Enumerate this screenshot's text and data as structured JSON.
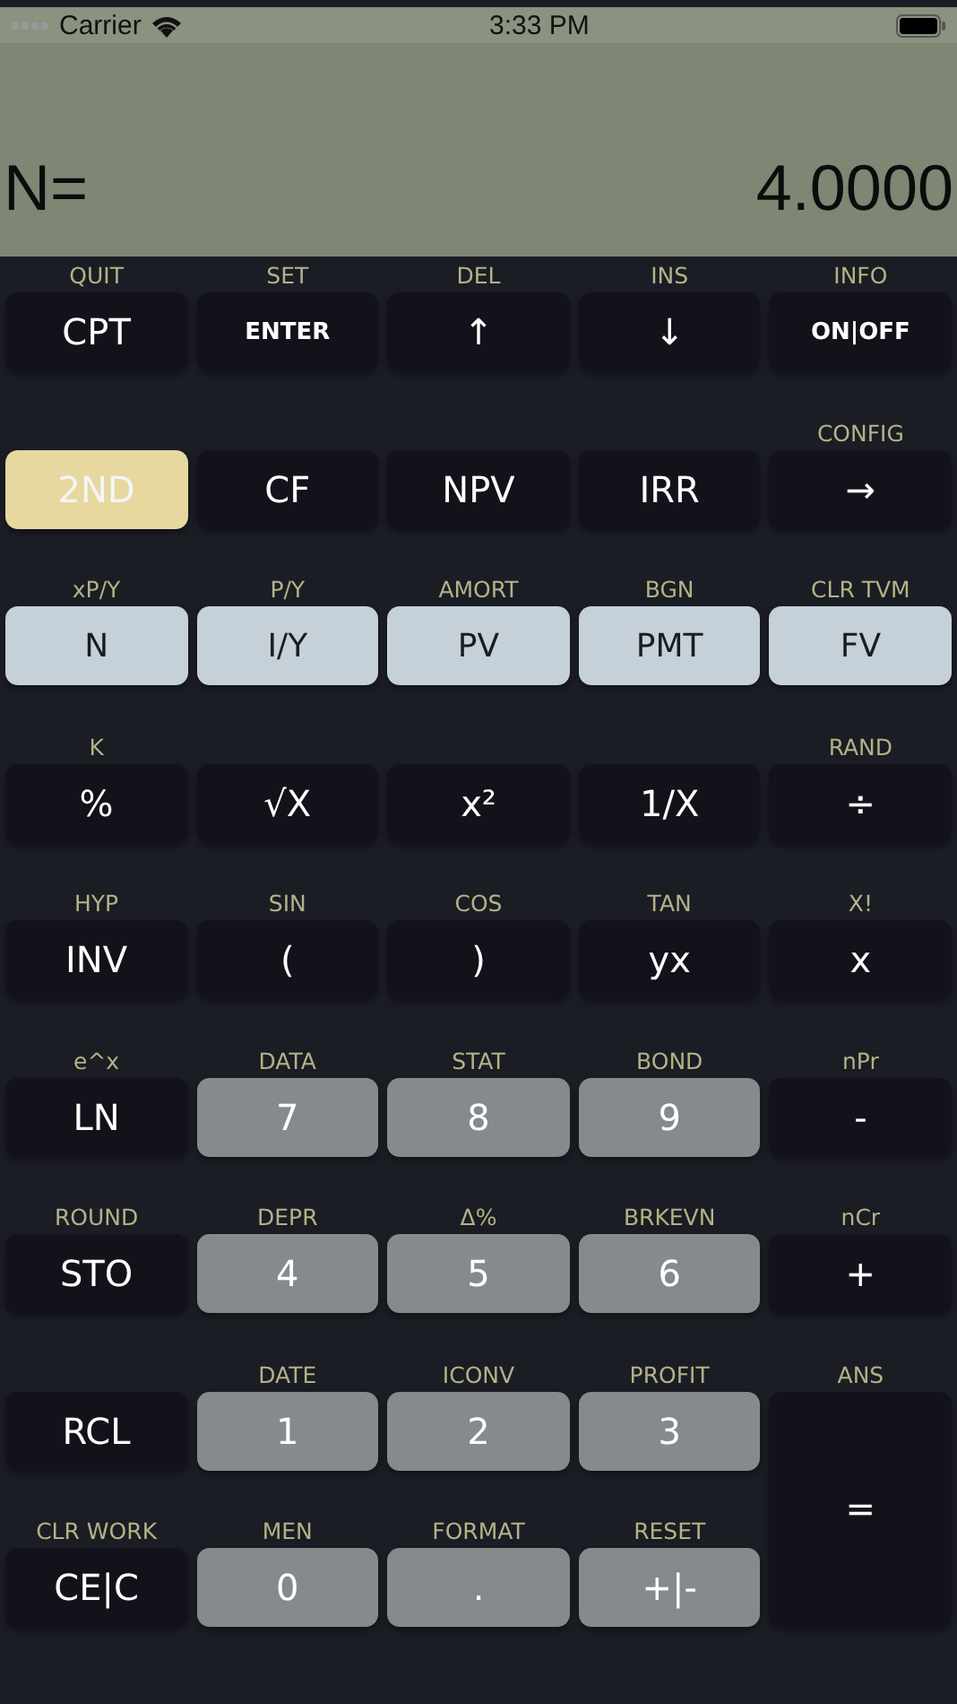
{
  "status_bar": {
    "carrier": "Carrier",
    "time": "3:33 PM"
  },
  "display": {
    "label": "N=",
    "value": "4.0000"
  },
  "keys": [
    {
      "top": "QUIT",
      "label": "CPT",
      "kind": "function"
    },
    {
      "top": "SET",
      "label": "ENTER",
      "kind": "small"
    },
    {
      "top": "DEL",
      "label": "↑",
      "kind": "function"
    },
    {
      "top": "INS",
      "label": "↓",
      "kind": "function"
    },
    {
      "top": "INFO",
      "label": "ON|OFF",
      "kind": "small"
    },
    {
      "label": "2ND",
      "kind": "second"
    },
    {
      "label": "CF",
      "kind": "function"
    },
    {
      "label": "NPV",
      "kind": "function"
    },
    {
      "label": "IRR",
      "kind": "function"
    },
    {
      "top": "CONFIG",
      "label": "→",
      "kind": "function"
    },
    {
      "top": "xP/Y",
      "label": "N",
      "kind": "tvm"
    },
    {
      "top": "P/Y",
      "label": "I/Y",
      "kind": "tvm"
    },
    {
      "top": "AMORT",
      "label": "PV",
      "kind": "tvm"
    },
    {
      "top": "BGN",
      "label": "PMT",
      "kind": "tvm"
    },
    {
      "top": "CLR TVM",
      "label": "FV",
      "kind": "tvm"
    },
    {
      "top": "K",
      "label": "%",
      "kind": "function"
    },
    {
      "label": "√X",
      "kind": "function"
    },
    {
      "label": "x²",
      "kind": "function"
    },
    {
      "label": "1/X",
      "kind": "function"
    },
    {
      "top": "RAND",
      "label": "÷",
      "kind": "function"
    },
    {
      "top": "HYP",
      "label": "INV",
      "kind": "function"
    },
    {
      "top": "SIN",
      "label": "(",
      "kind": "function"
    },
    {
      "top": "COS",
      "label": ")",
      "kind": "function"
    },
    {
      "top": "TAN",
      "label": "yx",
      "kind": "function"
    },
    {
      "top": "X!",
      "label": "x",
      "kind": "function"
    },
    {
      "top": "e^x",
      "label": "LN",
      "kind": "function"
    },
    {
      "top": "DATA",
      "label": "7",
      "kind": "digit"
    },
    {
      "top": "STAT",
      "label": "8",
      "kind": "digit"
    },
    {
      "top": "BOND",
      "label": "9",
      "kind": "digit"
    },
    {
      "top": "nPr",
      "label": "-",
      "kind": "function"
    },
    {
      "top": "ROUND",
      "label": "STO",
      "kind": "function"
    },
    {
      "top": "DEPR",
      "label": "4",
      "kind": "digit"
    },
    {
      "top": "Δ%",
      "label": "5",
      "kind": "digit"
    },
    {
      "top": "BRKEVN",
      "label": "6",
      "kind": "digit"
    },
    {
      "top": "nCr",
      "label": "+",
      "kind": "function"
    },
    {
      "label": "RCL",
      "kind": "function"
    },
    {
      "top": "DATE",
      "label": "1",
      "kind": "digit"
    },
    {
      "top": "ICONV",
      "label": "2",
      "kind": "digit"
    },
    {
      "top": "PROFIT",
      "label": "3",
      "kind": "digit"
    },
    {
      "top": "ANS",
      "label": "=",
      "kind": "tall"
    },
    {
      "top": "CLR WORK",
      "label": "CE|C",
      "kind": "function"
    },
    {
      "top": "MEN",
      "label": "0",
      "kind": "digit"
    },
    {
      "top": "FORMAT",
      "label": ".",
      "kind": "digit"
    },
    {
      "top": "RESET",
      "label": "+|-",
      "kind": "digit"
    }
  ]
}
